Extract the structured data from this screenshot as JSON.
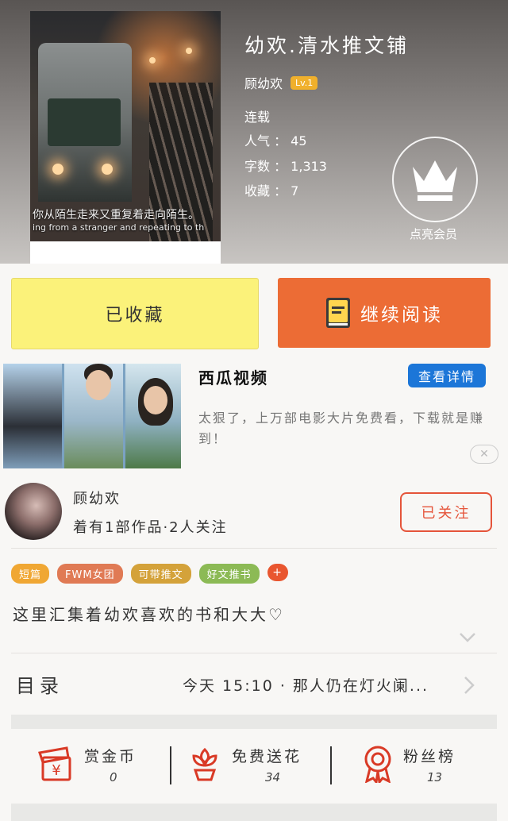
{
  "book": {
    "title": "幼欢.清水推文铺",
    "author": "顾幼欢",
    "level": "Lv.1",
    "status": "连载",
    "popularity": "人气 ： 45",
    "word_count": "字数 ： 1,313",
    "favorites": "收藏 ： 7",
    "vip_label": "点亮会员",
    "cover_caption_zh": "你从陌生走来又重复着走向陌生。",
    "cover_caption_en": "ing from a stranger and repeating to th"
  },
  "actions": {
    "favorited_label": "已收藏",
    "continue_label": "继续阅读"
  },
  "ad": {
    "title": "西瓜视频",
    "detail_button": "查看详情",
    "description": "太狠了，上万部电影大片免费看，下载就是赚到！",
    "close": "✕"
  },
  "author_card": {
    "name": "顾幼欢",
    "stats": "着有1部作品·2人关注",
    "follow_label": "已关注"
  },
  "tags": [
    {
      "label": "短篇",
      "color": "#f0a733"
    },
    {
      "label": "FWM女团",
      "color": "#e07a54"
    },
    {
      "label": "可带推文",
      "color": "#d4a23a"
    },
    {
      "label": "好文推书",
      "color": "#8cba55"
    }
  ],
  "tag_add": "+",
  "intro": "这里汇集着幼欢喜欢的书和大大♡",
  "toc": {
    "label": "目录",
    "latest": "今天 15:10 · 那人仍在灯火阑..."
  },
  "stats": {
    "coins": {
      "label": "赏金币",
      "value": "0"
    },
    "flowers": {
      "label": "免费送花",
      "value": "34"
    },
    "fans": {
      "label": "粉丝榜",
      "value": "13"
    }
  }
}
